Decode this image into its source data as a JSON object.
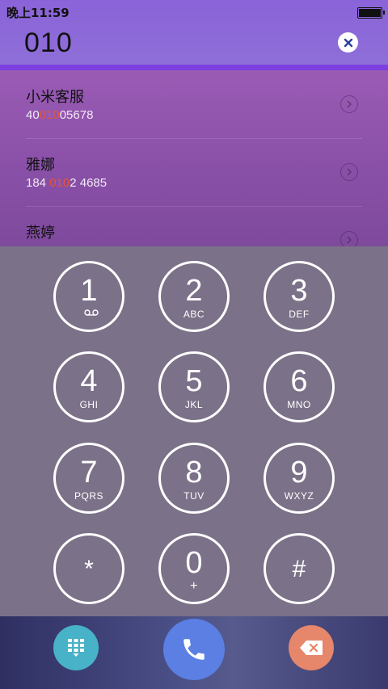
{
  "status_bar": {
    "time": "晚上11:59",
    "battery_level": 1.0
  },
  "dialer": {
    "input_value": "010",
    "clear_icon": "clear-x-icon"
  },
  "results": [
    {
      "name": "小米客服",
      "number_before": "40",
      "number_match": "010",
      "number_after": "05678"
    },
    {
      "name": "雅娜",
      "number_before": "184 ",
      "number_match": "010",
      "number_after": "2 4685"
    },
    {
      "name": "燕婷",
      "number_before": "",
      "number_match": "",
      "number_after": ""
    }
  ],
  "keypad": {
    "keys": [
      {
        "digit": "1",
        "letters": "",
        "icon": "voicemail-icon"
      },
      {
        "digit": "2",
        "letters": "ABC"
      },
      {
        "digit": "3",
        "letters": "DEF"
      },
      {
        "digit": "4",
        "letters": "GHI"
      },
      {
        "digit": "5",
        "letters": "JKL"
      },
      {
        "digit": "6",
        "letters": "MNO"
      },
      {
        "digit": "7",
        "letters": "PQRS"
      },
      {
        "digit": "8",
        "letters": "TUV"
      },
      {
        "digit": "9",
        "letters": "WXYZ"
      },
      {
        "digit": "*",
        "letters": ""
      },
      {
        "digit": "0",
        "letters": "+"
      },
      {
        "digit": "#",
        "letters": ""
      }
    ]
  },
  "bottom_bar": {
    "keypad_toggle_icon": "keypad-grid-icon",
    "call_icon": "phone-icon",
    "delete_icon": "backspace-icon"
  },
  "colors": {
    "header": "#8a63d8",
    "highlight": "#e8533a",
    "keypad_toggle": "#48b2c8",
    "call": "#5b7fe3",
    "delete": "#e6866a"
  }
}
